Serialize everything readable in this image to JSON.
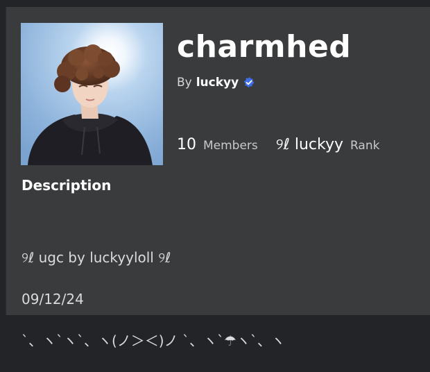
{
  "group": {
    "name": "charmhed",
    "by_label": "By",
    "owner": "luckyy",
    "members_count": "10",
    "members_label": "Members",
    "rank_value": "୨ℓ luckyy",
    "rank_label": "Rank"
  },
  "description": {
    "heading": "Description",
    "lines": [
      "୨ℓ ugc by luckyyloll ୨ℓ",
      "09/12/24",
      "`、ヽ`ヽ`、ヽ(ノ＞＜)ノ `、ヽ`☂ヽ`、ヽ"
    ]
  },
  "icons": {
    "verified": "verified-badge-icon"
  },
  "colors": {
    "background": "#232427",
    "panel": "#393b3d",
    "verified_blue": "#3f6fe8",
    "text_primary": "#ffffff",
    "text_secondary": "#c8c9cb"
  }
}
